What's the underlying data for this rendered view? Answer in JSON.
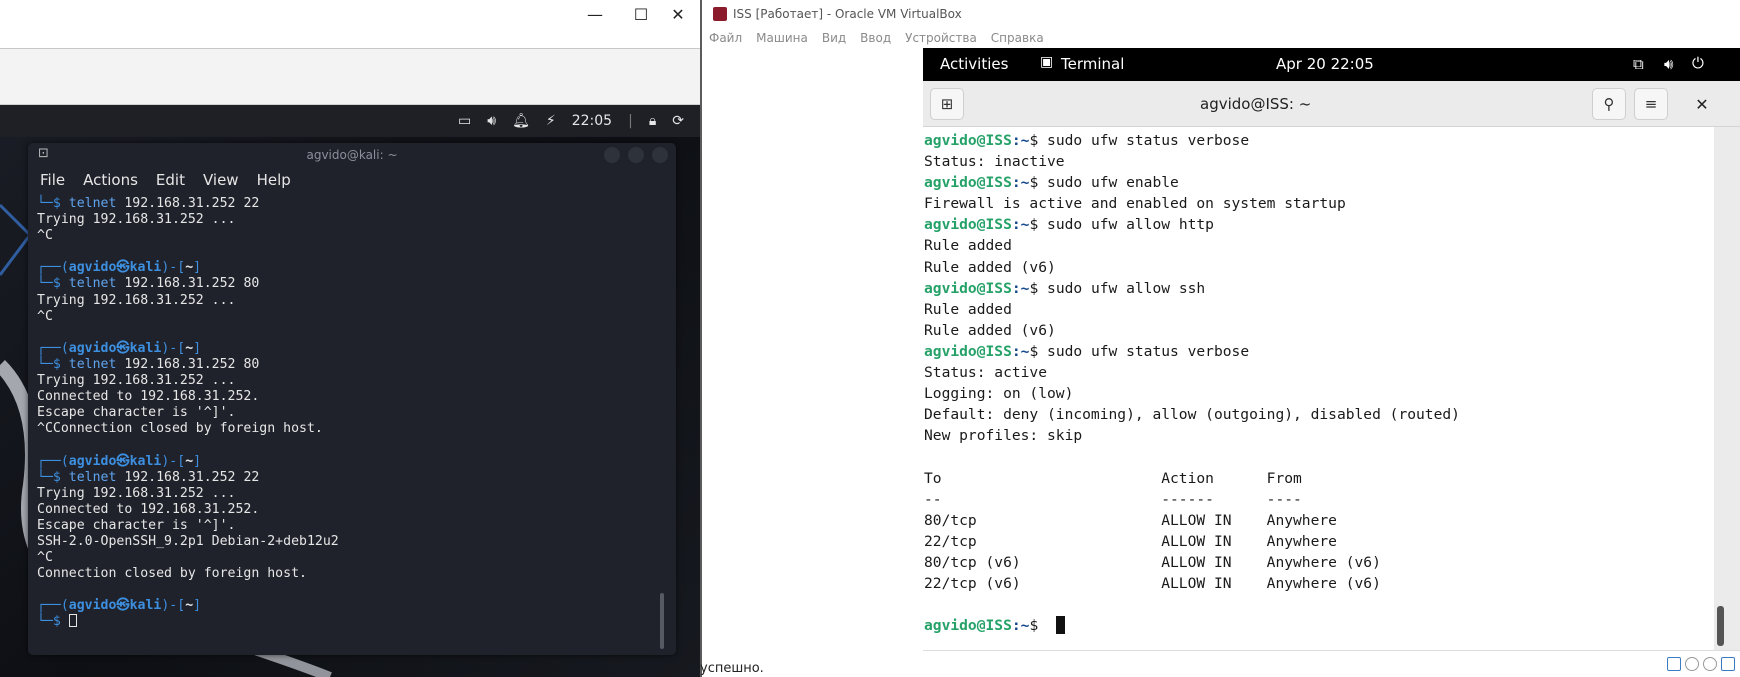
{
  "host_window": {
    "minimize_glyph": "—",
    "maximize_glyph": "☐",
    "close_glyph": "✕"
  },
  "kali": {
    "panel": {
      "time": "22:05"
    },
    "terminal": {
      "title": "agvido@kali: ~",
      "menu": [
        "File",
        "Actions",
        "Edit",
        "View",
        "Help"
      ],
      "lines": [
        {
          "kind": "cmd",
          "text": "telnet",
          "args": " 192.168.31.252 22"
        },
        {
          "kind": "out",
          "text": "Trying 192.168.31.252 ..."
        },
        {
          "kind": "out",
          "text": "^C"
        },
        {
          "kind": "blank",
          "text": ""
        },
        {
          "kind": "prompt",
          "user": "agvido",
          "at": "㉿",
          "host": "kali",
          "dir": "~"
        },
        {
          "kind": "cmd",
          "text": "telnet",
          "args": " 192.168.31.252 80"
        },
        {
          "kind": "out",
          "text": "Trying 192.168.31.252 ..."
        },
        {
          "kind": "out",
          "text": "^C"
        },
        {
          "kind": "blank",
          "text": ""
        },
        {
          "kind": "prompt",
          "user": "agvido",
          "at": "㉿",
          "host": "kali",
          "dir": "~"
        },
        {
          "kind": "cmd",
          "text": "telnet",
          "args": " 192.168.31.252 80"
        },
        {
          "kind": "out",
          "text": "Trying 192.168.31.252 ..."
        },
        {
          "kind": "out",
          "text": "Connected to 192.168.31.252."
        },
        {
          "kind": "out",
          "text": "Escape character is '^]'."
        },
        {
          "kind": "out",
          "text": "^CConnection closed by foreign host."
        },
        {
          "kind": "blank",
          "text": ""
        },
        {
          "kind": "prompt",
          "user": "agvido",
          "at": "㉿",
          "host": "kali",
          "dir": "~"
        },
        {
          "kind": "cmd",
          "text": "telnet",
          "args": " 192.168.31.252 22"
        },
        {
          "kind": "out",
          "text": "Trying 192.168.31.252 ..."
        },
        {
          "kind": "out",
          "text": "Connected to 192.168.31.252."
        },
        {
          "kind": "out",
          "text": "Escape character is '^]'."
        },
        {
          "kind": "out",
          "text": "SSH-2.0-OpenSSH_9.2p1 Debian-2+deb12u2"
        },
        {
          "kind": "out",
          "text": "^C"
        },
        {
          "kind": "out",
          "text": "Connection closed by foreign host."
        },
        {
          "kind": "blank",
          "text": ""
        },
        {
          "kind": "prompt",
          "user": "agvido",
          "at": "㉿",
          "host": "kali",
          "dir": "~"
        },
        {
          "kind": "cursor",
          "text": ""
        }
      ]
    }
  },
  "vbox": {
    "title": "ISS [Работает] - Oracle VM VirtualBox",
    "menu": [
      "Файл",
      "Машина",
      "Вид",
      "Ввод",
      "Устройства",
      "Справка"
    ],
    "status_text": "успешно."
  },
  "gnome": {
    "activities": "Activities",
    "app_name": "Terminal",
    "clock": "Apr 20  22:05",
    "terminal_title": "agvido@ISS: ~",
    "prompt_user": "agvido@ISS",
    "prompt_suffix": ":~$ ",
    "lines": [
      {
        "kind": "cmd",
        "text": "sudo ufw status verbose"
      },
      {
        "kind": "out",
        "text": "Status: inactive"
      },
      {
        "kind": "cmd",
        "text": "sudo ufw enable"
      },
      {
        "kind": "out",
        "text": "Firewall is active and enabled on system startup"
      },
      {
        "kind": "cmd",
        "text": "sudo ufw allow http"
      },
      {
        "kind": "out",
        "text": "Rule added"
      },
      {
        "kind": "out",
        "text": "Rule added (v6)"
      },
      {
        "kind": "cmd",
        "text": "sudo ufw allow ssh"
      },
      {
        "kind": "out",
        "text": "Rule added"
      },
      {
        "kind": "out",
        "text": "Rule added (v6)"
      },
      {
        "kind": "cmd",
        "text": "sudo ufw status verbose"
      },
      {
        "kind": "out",
        "text": "Status: active"
      },
      {
        "kind": "out",
        "text": "Logging: on (low)"
      },
      {
        "kind": "out",
        "text": "Default: deny (incoming), allow (outgoing), disabled (routed)"
      },
      {
        "kind": "out",
        "text": "New profiles: skip"
      },
      {
        "kind": "out",
        "text": ""
      },
      {
        "kind": "out",
        "text": "To                         Action      From"
      },
      {
        "kind": "out",
        "text": "--                         ------      ----"
      },
      {
        "kind": "out",
        "text": "80/tcp                     ALLOW IN    Anywhere"
      },
      {
        "kind": "out",
        "text": "22/tcp                     ALLOW IN    Anywhere"
      },
      {
        "kind": "out",
        "text": "80/tcp (v6)                ALLOW IN    Anywhere (v6)"
      },
      {
        "kind": "out",
        "text": "22/tcp (v6)                ALLOW IN    Anywhere (v6)"
      },
      {
        "kind": "out",
        "text": ""
      },
      {
        "kind": "cursor",
        "text": ""
      }
    ]
  }
}
